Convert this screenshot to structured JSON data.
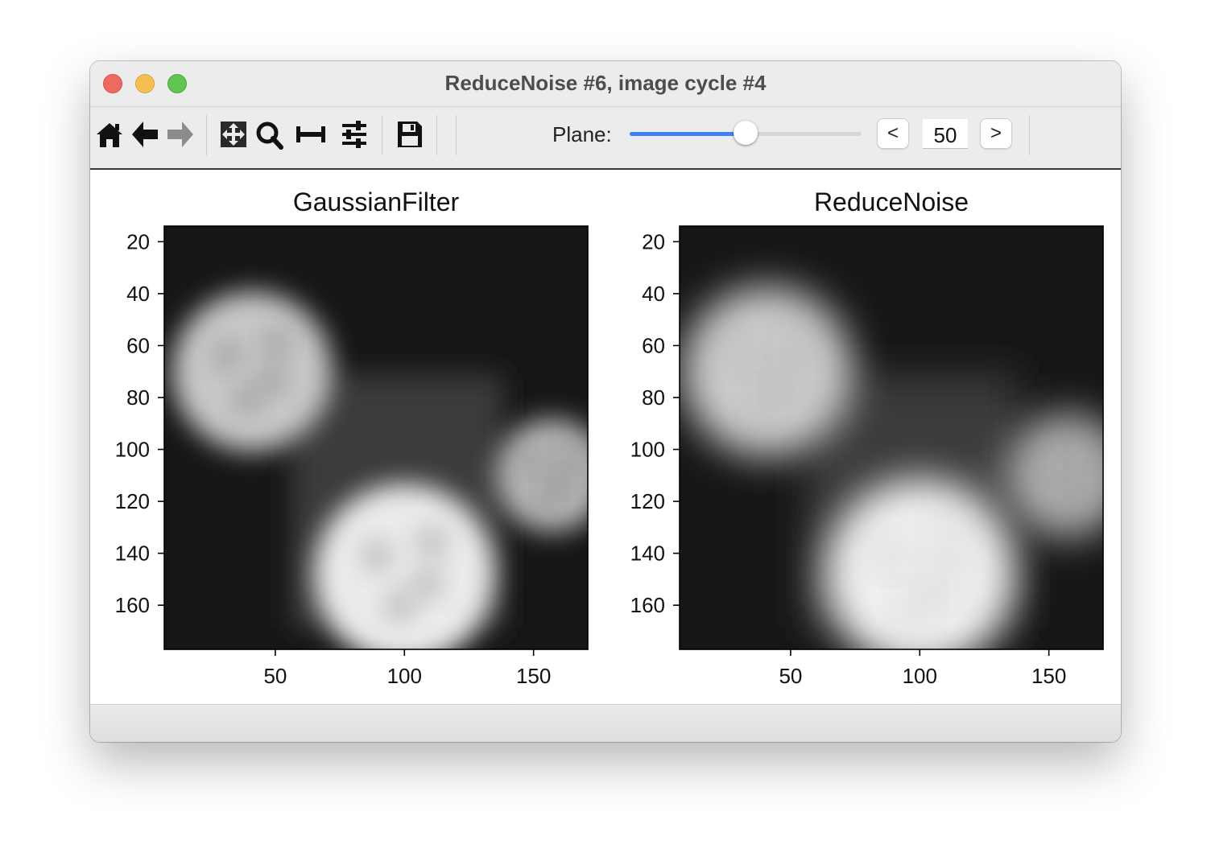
{
  "window": {
    "title": "ReduceNoise #6, image cycle #4"
  },
  "toolbar": {
    "buttons": [
      {
        "name": "home-icon"
      },
      {
        "name": "back-arrow-icon"
      },
      {
        "name": "forward-arrow-icon"
      },
      {
        "name": "pan-icon"
      },
      {
        "name": "zoom-icon"
      },
      {
        "name": "subplots-icon"
      },
      {
        "name": "configure-icon"
      },
      {
        "name": "save-icon"
      }
    ],
    "plane_label": "Plane:",
    "plane_value": "50",
    "plane_level": 0.5,
    "prev_label": "<",
    "next_label": ">",
    "accent_color": "#3f82f7"
  },
  "chart_data": [
    {
      "type": "heatmap",
      "title": "GaussianFilter",
      "colormap": "gray",
      "xticks": [
        50,
        100,
        150
      ],
      "yticks": [
        20,
        40,
        60,
        80,
        100,
        120,
        140,
        160
      ],
      "xlim": [
        7,
        171
      ],
      "ylim": [
        177,
        14
      ],
      "blobs": [
        {
          "x": 41,
          "y": 70,
          "r": 31,
          "intensity": 0.78
        },
        {
          "x": 100,
          "y": 148,
          "r": 35,
          "intensity": 0.92
        },
        {
          "x": 157,
          "y": 110,
          "r": 22,
          "intensity": 0.7
        }
      ]
    },
    {
      "type": "heatmap",
      "title": "ReduceNoise",
      "colormap": "gray",
      "xticks": [
        50,
        100,
        150
      ],
      "yticks": [
        20,
        40,
        60,
        80,
        100,
        120,
        140,
        160
      ],
      "xlim": [
        7,
        171
      ],
      "ylim": [
        177,
        14
      ],
      "blobs": [
        {
          "x": 41,
          "y": 70,
          "r": 33,
          "intensity": 0.8
        },
        {
          "x": 100,
          "y": 148,
          "r": 37,
          "intensity": 0.94
        },
        {
          "x": 157,
          "y": 110,
          "r": 24,
          "intensity": 0.68
        }
      ]
    }
  ]
}
